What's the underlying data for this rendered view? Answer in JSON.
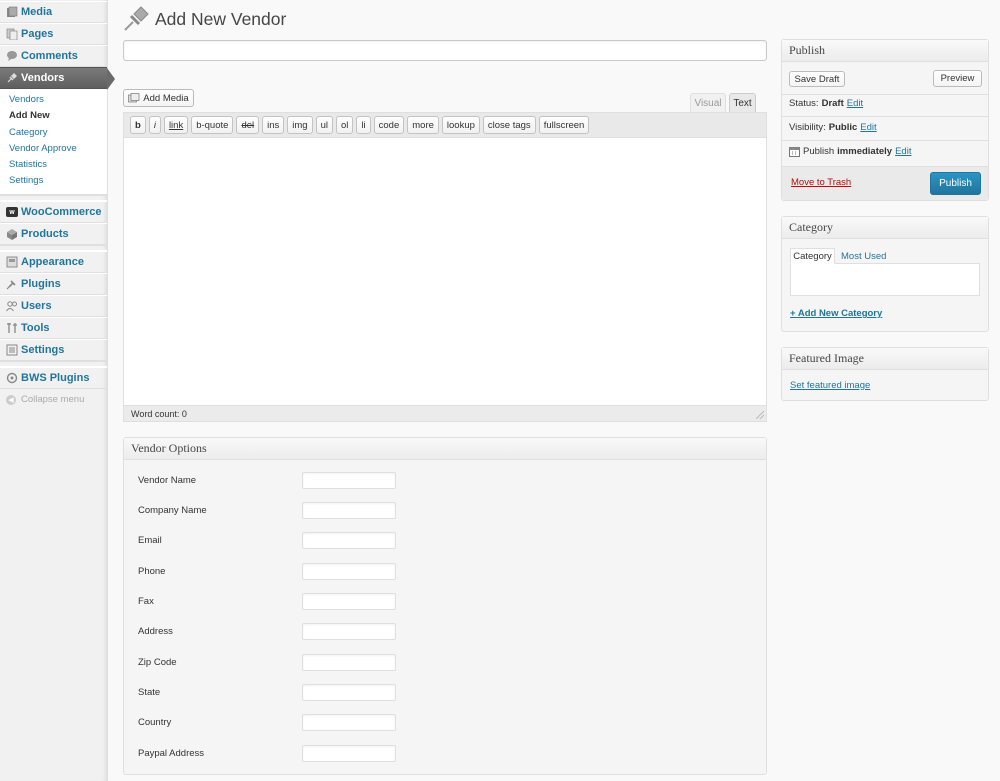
{
  "sidebar": {
    "items": [
      {
        "label": "Media",
        "icon": "media-icon"
      },
      {
        "label": "Pages",
        "icon": "pages-icon"
      },
      {
        "label": "Comments",
        "icon": "comments-icon"
      },
      {
        "label": "Vendors",
        "icon": "pin-icon",
        "active": true
      },
      {
        "label": "WooCommerce",
        "icon": "woocommerce-icon"
      },
      {
        "label": "Products",
        "icon": "products-icon"
      },
      {
        "label": "Appearance",
        "icon": "appearance-icon"
      },
      {
        "label": "Plugins",
        "icon": "plugins-icon"
      },
      {
        "label": "Users",
        "icon": "users-icon"
      },
      {
        "label": "Tools",
        "icon": "tools-icon"
      },
      {
        "label": "Settings",
        "icon": "settings-icon"
      },
      {
        "label": "BWS Plugins",
        "icon": "bws-icon"
      }
    ],
    "submenu": [
      "Vendors",
      "Add New",
      "Category",
      "Vendor Approve",
      "Statistics",
      "Settings"
    ],
    "submenu_current": "Add New",
    "collapse_label": "Collapse menu"
  },
  "header": {
    "title": "Add New Vendor"
  },
  "title_input": {
    "value": ""
  },
  "editor": {
    "add_media_label": "Add Media",
    "tabs": {
      "visual": "Visual",
      "text": "Text",
      "active": "Text"
    },
    "quicktags": [
      "b",
      "i",
      "link",
      "b-quote",
      "del",
      "ins",
      "img",
      "ul",
      "ol",
      "li",
      "code",
      "more",
      "lookup",
      "close tags",
      "fullscreen"
    ],
    "content": "",
    "word_count": "Word count: 0"
  },
  "vendor_options": {
    "title": "Vendor Options",
    "fields": [
      {
        "label": "Vendor Name",
        "value": ""
      },
      {
        "label": "Company Name",
        "value": ""
      },
      {
        "label": "Email",
        "value": ""
      },
      {
        "label": "Phone",
        "value": ""
      },
      {
        "label": "Fax",
        "value": ""
      },
      {
        "label": "Address",
        "value": ""
      },
      {
        "label": "Zip Code",
        "value": ""
      },
      {
        "label": "State",
        "value": ""
      },
      {
        "label": "Country",
        "value": ""
      },
      {
        "label": "Paypal Address",
        "value": ""
      }
    ]
  },
  "publish": {
    "title": "Publish",
    "save_draft": "Save Draft",
    "preview": "Preview",
    "status_label": "Status:",
    "status_value": "Draft",
    "visibility_label": "Visibility:",
    "visibility_value": "Public",
    "publish_label": "Publish",
    "publish_value": "immediately",
    "edit": "Edit",
    "trash": "Move to Trash",
    "publish_button": "Publish"
  },
  "category": {
    "title": "Category",
    "tab_all": "Category",
    "tab_most": "Most Used",
    "add_link": "+ Add New Category"
  },
  "featured": {
    "title": "Featured Image",
    "link": "Set featured image"
  },
  "colors": {
    "link": "#21759b",
    "trash": "#bc0b0b",
    "primary": "#21759b"
  }
}
